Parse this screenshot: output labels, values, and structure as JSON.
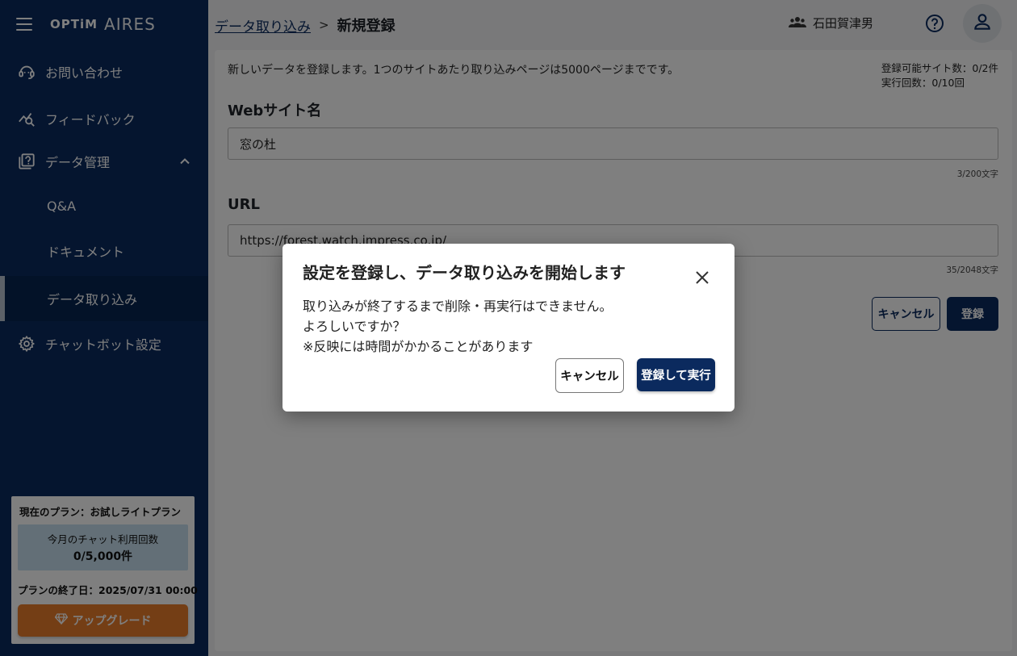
{
  "brand": {
    "logo_optim": "OPTiM",
    "logo_aires": "AIRES"
  },
  "sidebar": {
    "items": [
      {
        "label": "お問い合わせ",
        "icon": "support-agent-icon"
      },
      {
        "label": "フィードバック",
        "icon": "feedback-chart-icon"
      },
      {
        "label": "データ管理",
        "icon": "data-library-icon"
      },
      {
        "label": "Q&A"
      },
      {
        "label": "ドキュメント"
      },
      {
        "label": "データ取り込み"
      },
      {
        "label": "チャットボット設定",
        "icon": "gear-icon"
      }
    ],
    "plan": {
      "title": "現在のプラン：お試しライトプラン",
      "usage_label": "今月のチャット利用回数",
      "usage_value": "0/5,000件",
      "end_date": "プランの終了日：2025/07/31 00:00",
      "upgrade_label": "アップグレード"
    }
  },
  "header": {
    "breadcrumb_link": "データ取り込み",
    "breadcrumb_sep": ">",
    "breadcrumb_current": "新規登録",
    "user_name": "石田賀津男"
  },
  "form": {
    "intro": "新しいデータを登録します。1つのサイトあたり取り込みページは5000ページまでです。",
    "quota_sites": "登録可能サイト数：0/2件",
    "quota_runs": "実行回数：0/10回",
    "site_name_label": "Webサイト名",
    "site_name_value": "窓の杜",
    "site_name_count": "3/200文字",
    "url_label": "URL",
    "url_value": "https://forest.watch.impress.co.jp/",
    "url_count": "35/2048文字",
    "cancel_label": "キャンセル",
    "register_label": "登録"
  },
  "dialog": {
    "title": "設定を登録し、データ取り込みを開始します",
    "line1": "取り込みが終了するまで削除・再実行はできません。",
    "line2": "よろしいですか？",
    "line3": "※反映には時間がかかることがあります",
    "cancel_label": "キャンセル",
    "confirm_label": "登録して実行"
  },
  "colors": {
    "navy": "#0b2a5e",
    "accent_orange": "#e87c2a",
    "usage_bg": "#c6dfee"
  }
}
